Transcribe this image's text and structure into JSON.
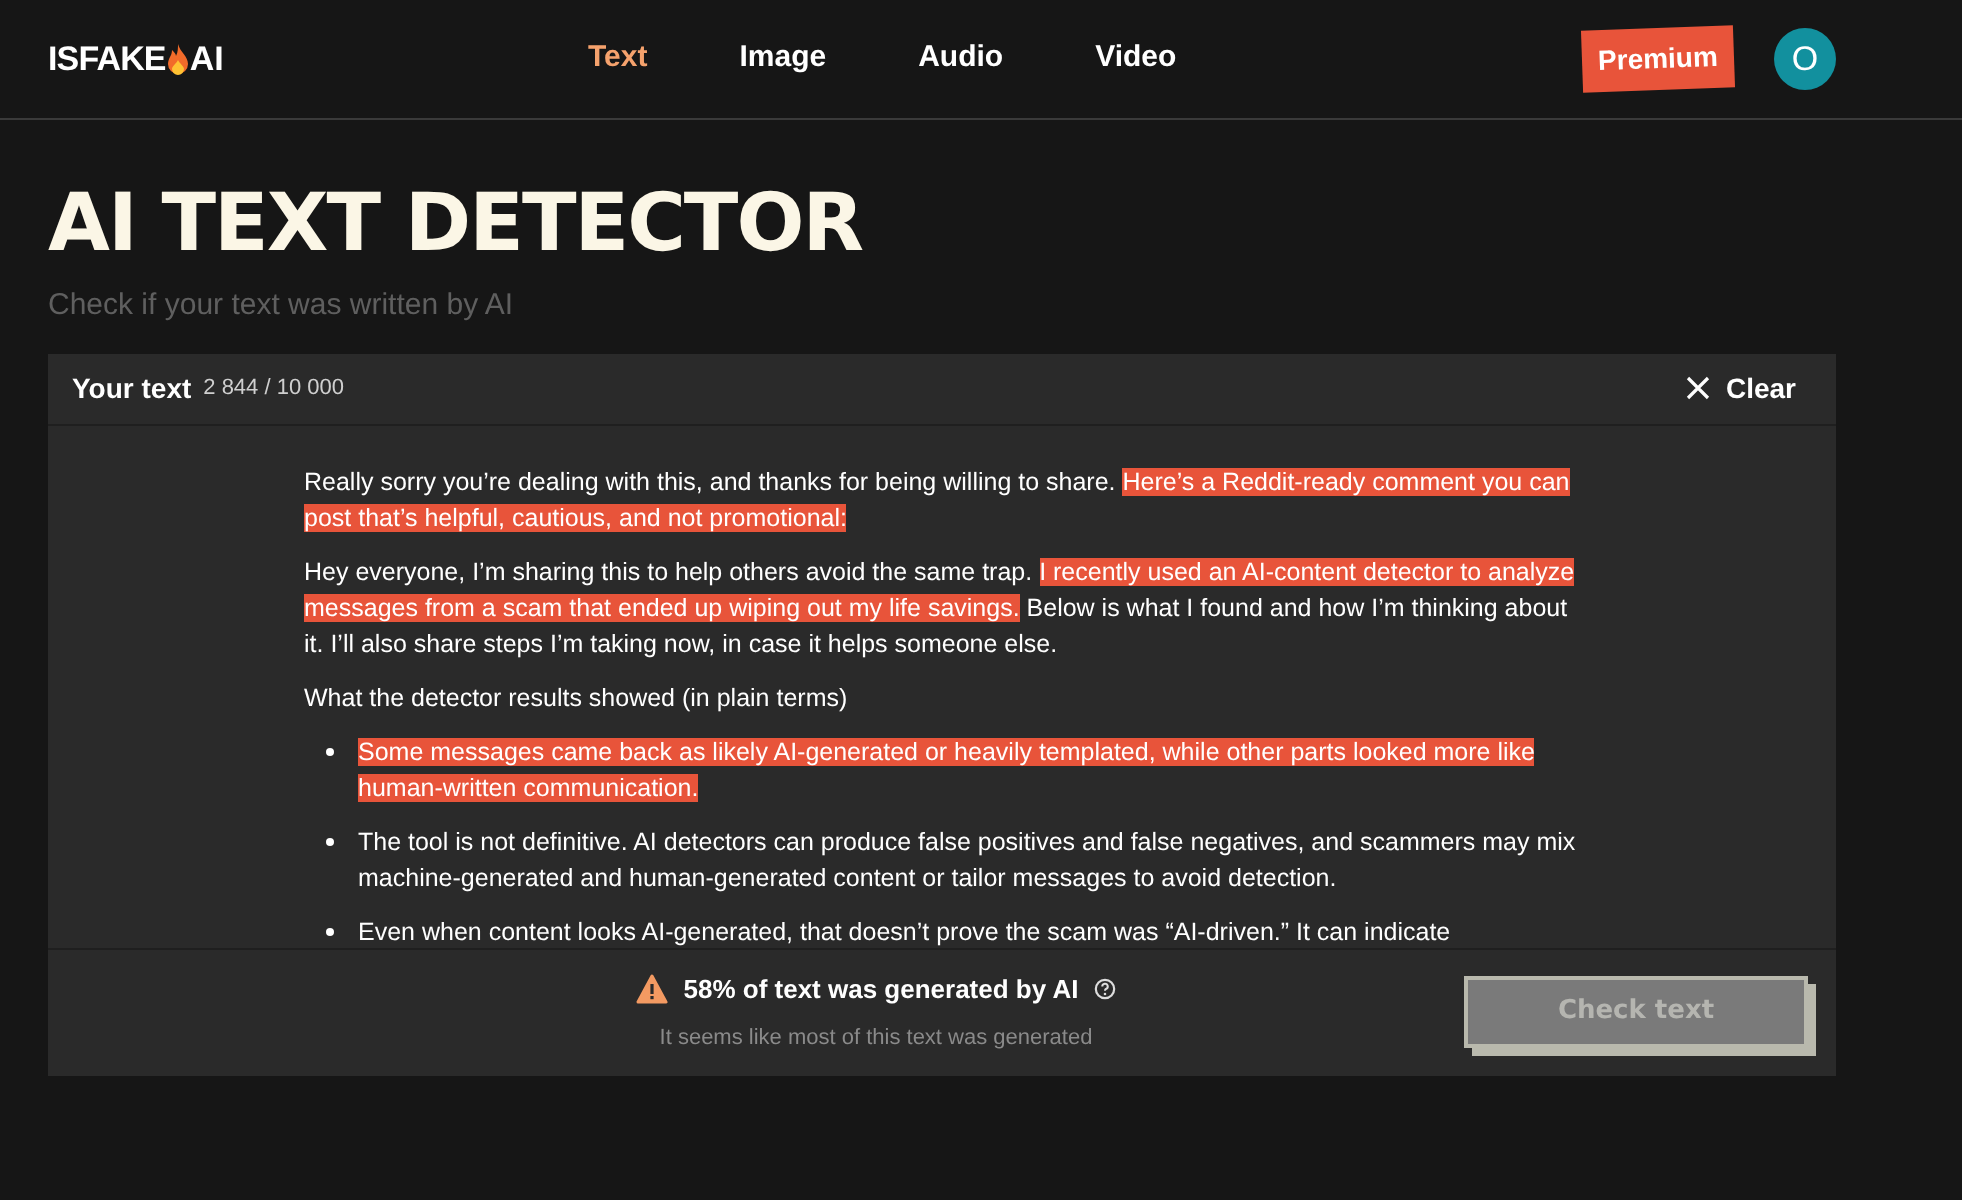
{
  "logo": {
    "before": "ISFAKE",
    "after": "AI"
  },
  "nav": [
    {
      "label": "Text",
      "selected": true
    },
    {
      "label": "Image",
      "selected": false
    },
    {
      "label": "Audio",
      "selected": false
    },
    {
      "label": "Video",
      "selected": false
    }
  ],
  "premium": "Premium",
  "avatar": "O",
  "title": "AI TEXT DETECTOR",
  "subtitle": "Check if your text was written by AI",
  "panel": {
    "label": "Your text",
    "count": "2 844 / 10 000",
    "clear": "Clear",
    "blocks": [
      {
        "kind": "paragraph",
        "segments": [
          {
            "text": "Really sorry you’re dealing with this, and thanks for being willing to share. ",
            "highlighted": false
          },
          {
            "text": "Here’s a Reddit-ready comment you can post that’s helpful, cautious, and not promotional:",
            "highlighted": true
          }
        ]
      },
      {
        "kind": "paragraph",
        "segments": [
          {
            "text": "Hey everyone, I’m sharing this to help others avoid the same trap. ",
            "highlighted": false
          },
          {
            "text": "I recently used an AI-content detector to analyze messages from a scam that ended up wiping out my life savings.",
            "highlighted": true
          },
          {
            "text": " Below is what I found and how I’m thinking about it. I’ll also share steps I’m taking now, in case it helps someone else.",
            "highlighted": false
          }
        ]
      },
      {
        "kind": "paragraph",
        "segments": [
          {
            "text": "What the detector results showed (in plain terms)",
            "highlighted": false
          }
        ]
      },
      {
        "kind": "bullet",
        "segments": [
          {
            "text": "Some messages came back as likely AI-generated or heavily templated, while other parts looked more like human-written communication.",
            "highlighted": true
          }
        ]
      },
      {
        "kind": "bullet",
        "segments": [
          {
            "text": "The tool is not definitive. AI detectors can produce false positives and false negatives, and scammers may mix machine-generated and human-generated content or tailor messages to avoid detection.",
            "highlighted": false
          }
        ]
      },
      {
        "kind": "bullet",
        "segments": [
          {
            "text": "Even when content looks AI-generated, that doesn’t prove the scam was “AI-driven.” It can indicate",
            "highlighted": false
          }
        ]
      }
    ],
    "result": "58% of text was generated by AI",
    "result_note": "It seems like most of this text was generated",
    "check": {
      "label": "Check text",
      "disabled": true
    }
  }
}
